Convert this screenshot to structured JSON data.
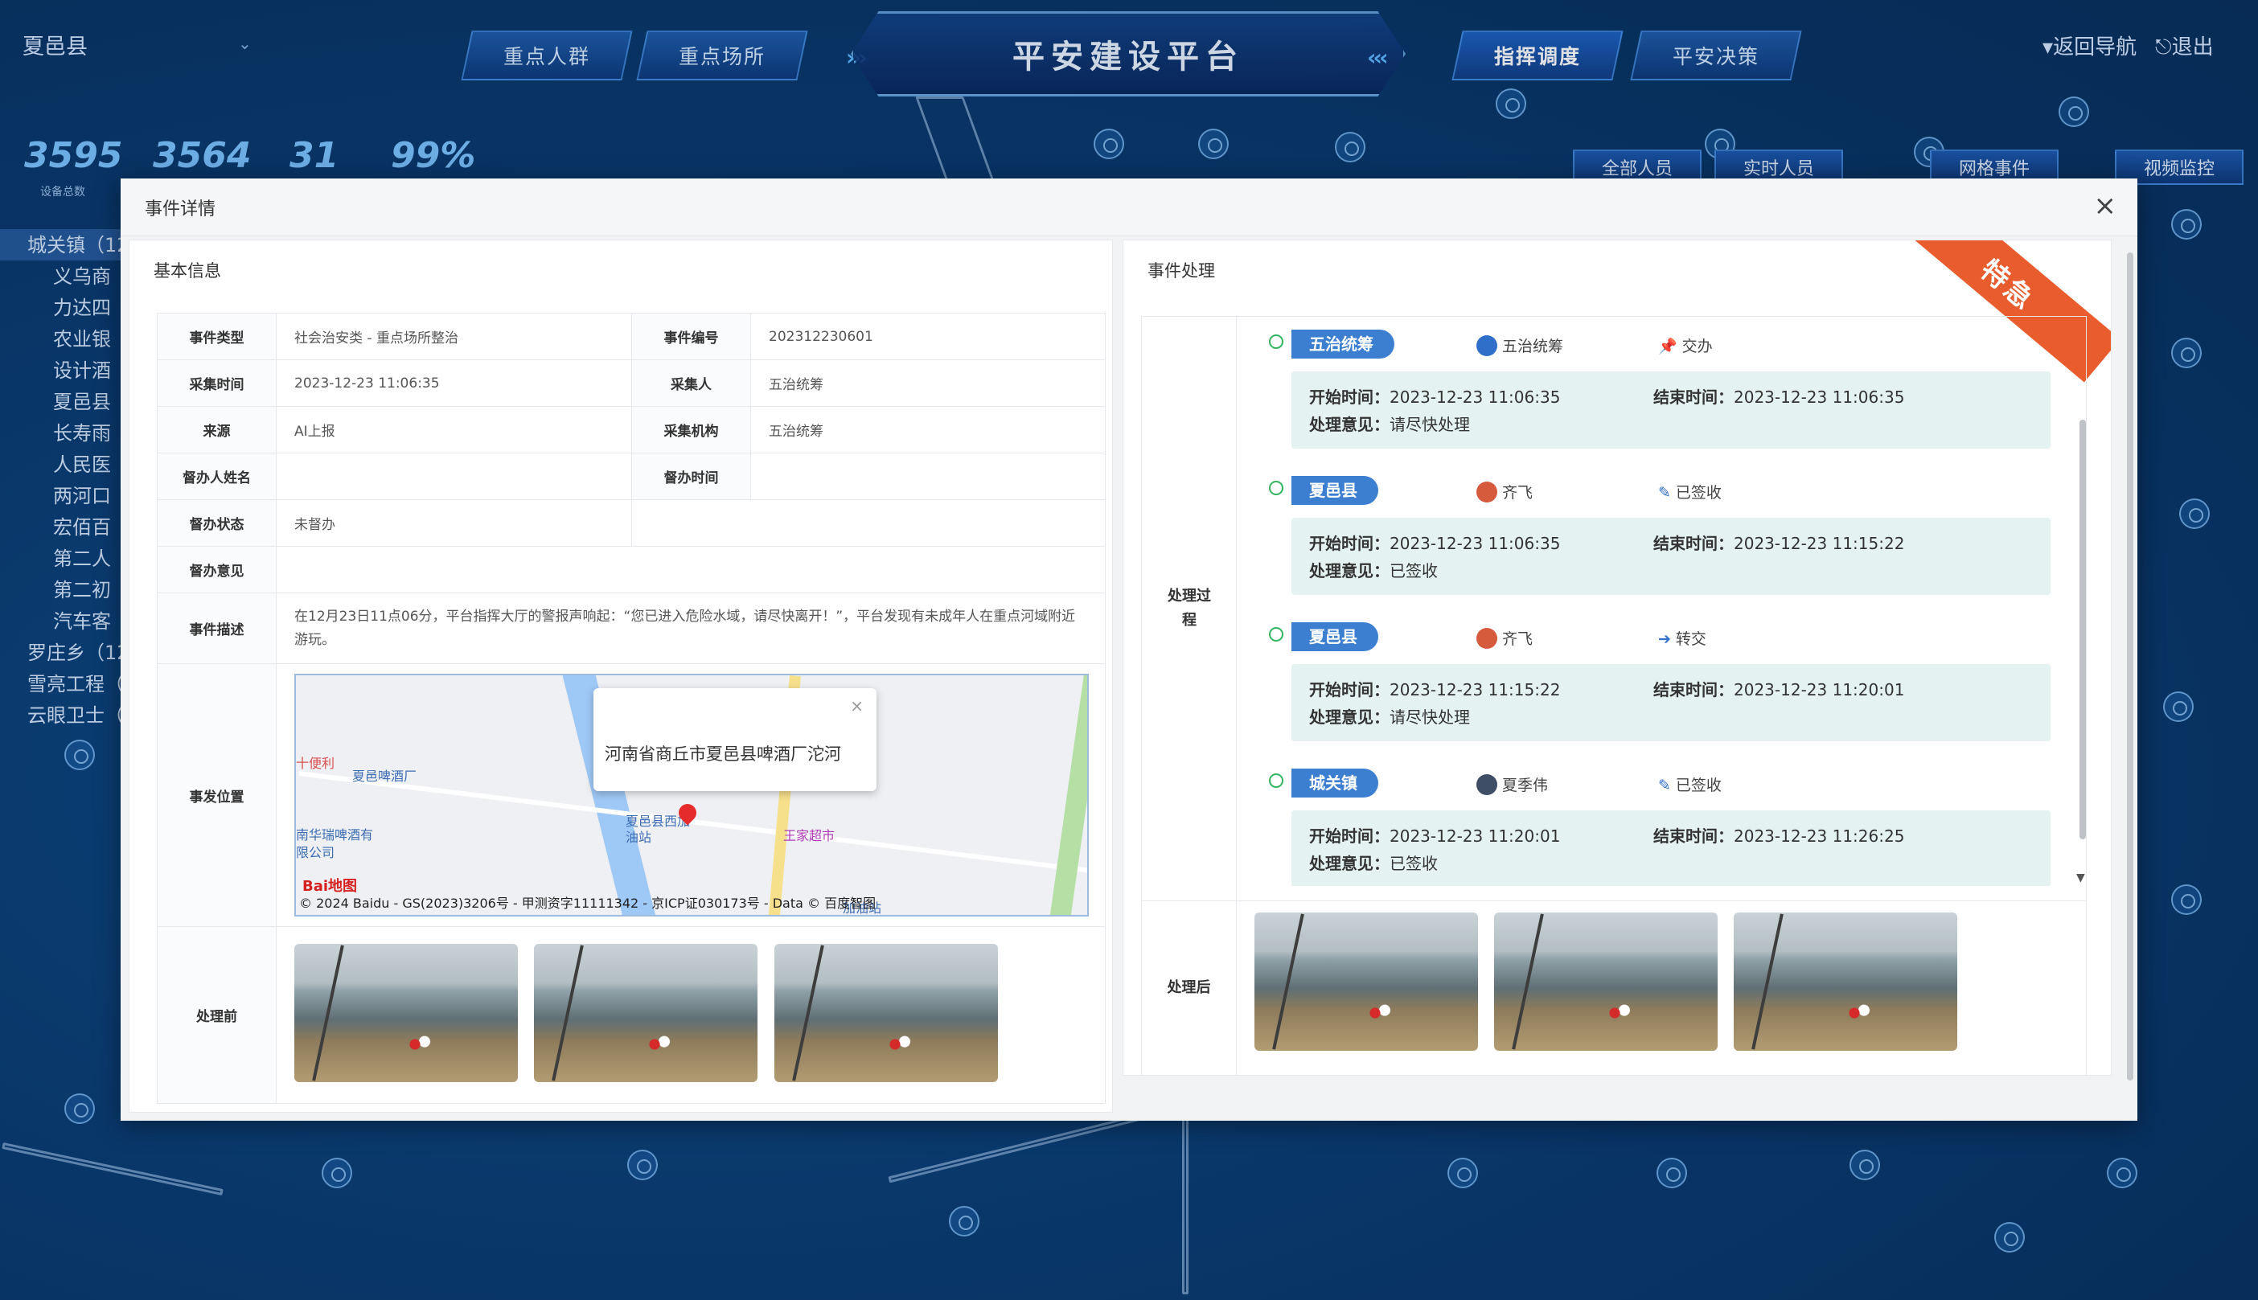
{
  "header": {
    "county": "夏邑县",
    "nav_left": [
      "重点人群",
      "重点场所"
    ],
    "title": "平安建设平台",
    "nav_right": [
      "指挥调度",
      "平安决策"
    ],
    "return_nav": "返回导航",
    "logout": "退出",
    "title_left_icon": "chevron-right-icon",
    "title_right_icon": "chevron-left-icon"
  },
  "stats": [
    {
      "value": "3595",
      "label": "设备总数"
    },
    {
      "value": "3564",
      "label": ""
    },
    {
      "value": "31",
      "label": ""
    },
    {
      "value": "99%",
      "label": ""
    }
  ],
  "tree": {
    "items": [
      {
        "label": "城关镇（12",
        "level": "top",
        "active": true
      },
      {
        "label": "义乌商",
        "level": "child"
      },
      {
        "label": "力达四",
        "level": "child"
      },
      {
        "label": "农业银",
        "level": "child"
      },
      {
        "label": "设计酒",
        "level": "child"
      },
      {
        "label": "夏邑县",
        "level": "child"
      },
      {
        "label": "长寿雨",
        "level": "child"
      },
      {
        "label": "人民医",
        "level": "child"
      },
      {
        "label": "两河口",
        "level": "child"
      },
      {
        "label": "宏佰百",
        "level": "child"
      },
      {
        "label": "第二人",
        "level": "child"
      },
      {
        "label": "第二初",
        "level": "child"
      },
      {
        "label": "汽车客",
        "level": "child"
      },
      {
        "label": "罗庄乡（12",
        "level": "top"
      },
      {
        "label": "雪亮工程（",
        "level": "top"
      },
      {
        "label": "云眼卫士（",
        "level": "top"
      }
    ]
  },
  "right_tabs": [
    "全部人员",
    "实时人员",
    "网格事件",
    "视频监控"
  ],
  "modal": {
    "title": "事件详情",
    "basic": {
      "title": "基本信息",
      "event_type_k": "事件类型",
      "event_type_v": "社会治安类 - 重点场所整治",
      "event_no_k": "事件编号",
      "event_no_v": "202312230601",
      "collect_time_k": "采集时间",
      "collect_time_v": "2023-12-23 11:06:35",
      "collector_k": "采集人",
      "collector_v": "五治统筹",
      "source_k": "来源",
      "source_v": "AI上报",
      "org_k": "采集机构",
      "org_v": "五治统筹",
      "supervisor_k": "督办人姓名",
      "supervisor_v": "",
      "supervise_time_k": "督办时间",
      "supervise_time_v": "",
      "supervise_status_k": "督办状态",
      "supervise_status_v": "未督办",
      "supervise_opinion_k": "督办意见",
      "supervise_opinion_v": "",
      "desc_k": "事件描述",
      "desc_v": "在12月23日11点06分，平台指挥大厅的警报声响起：“您已进入危险水域，请尽快离开！”，平台发现有未成年人在重点河域附近游玩。",
      "location_k": "事发位置",
      "before_k": "处理前"
    },
    "map": {
      "popup": "河南省商丘市夏邑县啤酒厂沱河",
      "labels": [
        "夏邑啤酒厂",
        "南华瑞啤酒有限公司",
        "夏邑县西加油站",
        "王家超市",
        "十便利",
        "加油站"
      ],
      "copyright": "© 2024 Baidu - GS(2023)3206号 - 甲测资字11111342 - 京ICP证030173号 - Data © 百度智图",
      "logo": "Bai地图"
    },
    "process": {
      "title": "事件处理",
      "urgent": "特急",
      "process_k": "处理过程",
      "after_k": "处理后",
      "start_label": "开始时间：",
      "end_label": "结束时间：",
      "opinion_label": "处理意见：",
      "steps": [
        {
          "dept": "五治统筹",
          "person": "五治统筹",
          "action": "交办",
          "action_icon": "pin-icon",
          "start": "2023-12-23 11:06:35",
          "end": "2023-12-23 11:06:35",
          "opinion": "请尽快处理"
        },
        {
          "dept": "夏邑县",
          "person": "齐飞",
          "action": "已签收",
          "action_icon": "pencil-icon",
          "start": "2023-12-23 11:06:35",
          "end": "2023-12-23 11:15:22",
          "opinion": "已签收"
        },
        {
          "dept": "夏邑县",
          "person": "齐飞",
          "action": "转交",
          "action_icon": "arrow-right-circle-icon",
          "start": "2023-12-23 11:15:22",
          "end": "2023-12-23 11:20:01",
          "opinion": "请尽快处理"
        },
        {
          "dept": "城关镇",
          "person": "夏季伟",
          "action": "已签收",
          "action_icon": "pencil-icon",
          "start": "2023-12-23 11:20:01",
          "end": "2023-12-23 11:26:25",
          "opinion": "已签收"
        }
      ]
    }
  },
  "colors": {
    "accent": "#3c7ecf",
    "urgent": "#e85c2e",
    "timeline_dot": "#33b45e",
    "detail_bg": "#e4f2f1"
  }
}
